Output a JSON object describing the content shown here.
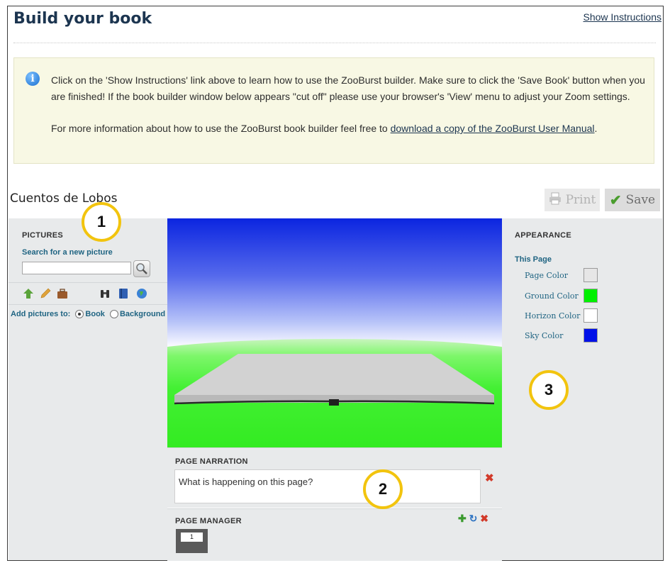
{
  "header": {
    "title": "Build your book",
    "show_instructions": "Show Instructions"
  },
  "info": {
    "paragraph1": "Click on the 'Show Instructions' link above to learn how to use the ZooBurst builder. Make sure to click the 'Save Book' button when you are finished! If the book builder window below appears \"cut off\" please use your browser's 'View' menu to adjust your Zoom settings.",
    "paragraph2_prefix": "For more information about how to use the ZooBurst book builder feel free to ",
    "manual_link": "download a copy of the ZooBurst User Manual",
    "paragraph2_suffix": "."
  },
  "book": {
    "title": "Cuentos de Lobos",
    "print_label": "Print",
    "save_label": "Save"
  },
  "pictures": {
    "heading": "PICTURES",
    "search_label": "Search for a new picture",
    "search_value": "",
    "add_to_label": "Add pictures to:",
    "option_book": "Book",
    "option_background": "Background",
    "selected": "Book",
    "tools": [
      "upload-icon",
      "pencil-icon",
      "briefcase-icon",
      "binoculars-icon",
      "book-icon",
      "globe-icon"
    ]
  },
  "narration": {
    "heading": "PAGE NARRATION",
    "text": "What is happening on this page?"
  },
  "page_manager": {
    "heading": "PAGE MANAGER",
    "pages": [
      "1"
    ]
  },
  "appearance": {
    "heading": "APPEARANCE",
    "this_page": "This Page",
    "colors": [
      {
        "label": "Page Color",
        "value": "#e6e6e6"
      },
      {
        "label": "Ground Color",
        "value": "#00f000"
      },
      {
        "label": "Horizon Color",
        "value": "#ffffff"
      },
      {
        "label": "Sky Color",
        "value": "#0010e8"
      }
    ]
  },
  "badges": [
    "1",
    "2",
    "3"
  ],
  "colors": {
    "title": "#1c3550",
    "link_blue": "#1f6482",
    "panel_bg": "#e8eaeb",
    "badge_ring": "#f2c40e"
  }
}
